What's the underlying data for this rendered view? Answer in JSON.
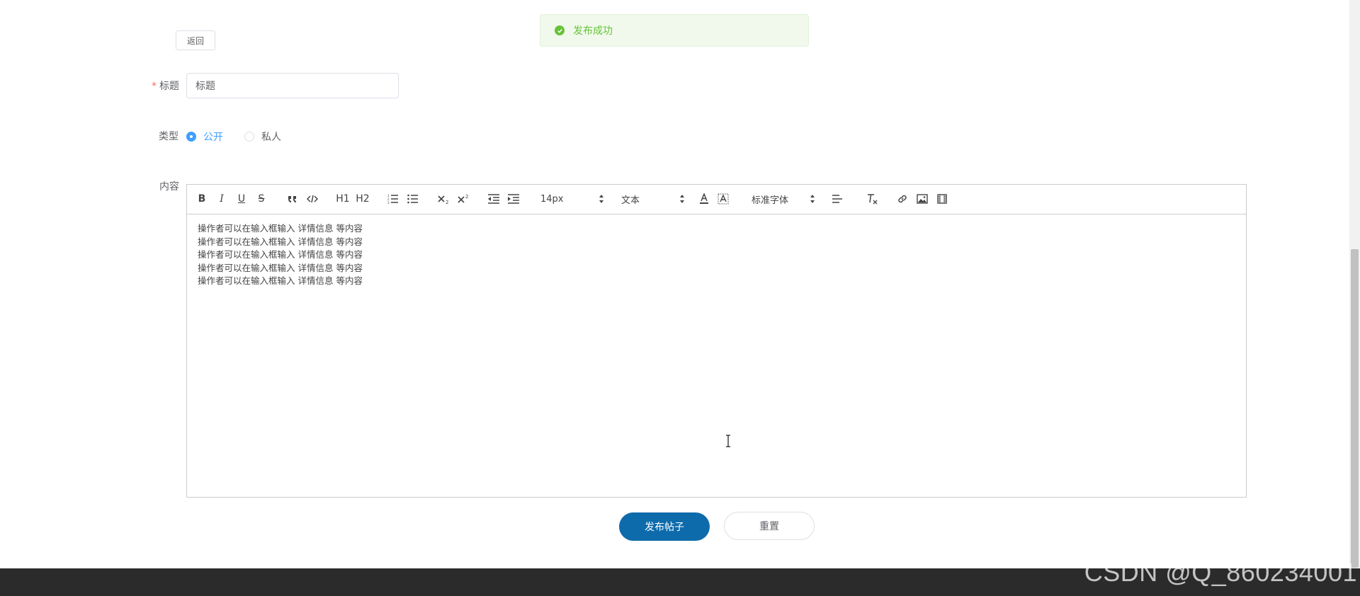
{
  "toast": {
    "message": "发布成功",
    "icon": "success-check-icon",
    "color": "#67c23a"
  },
  "back_button": {
    "label": "返回"
  },
  "form": {
    "title": {
      "required_mark": "*",
      "label": "标题",
      "value": "标题"
    },
    "type": {
      "label": "类型",
      "options": [
        {
          "label": "公开",
          "checked": true
        },
        {
          "label": "私人",
          "checked": false
        }
      ]
    },
    "content": {
      "label": "内容"
    }
  },
  "editor": {
    "toolbar": {
      "bold": "B",
      "italic": "I",
      "underline": "U",
      "strike": "S",
      "h1": "H1",
      "h2": "H2",
      "size": "14px",
      "header": "文本",
      "font": "标准字体"
    },
    "lines": [
      "操作者可以在输入框输入 详情信息 等内容",
      "操作者可以在输入框输入 详情信息 等内容",
      "操作者可以在输入框输入 详情信息 等内容",
      "操作者可以在输入框输入 详情信息 等内容",
      "操作者可以在输入框输入 详情信息 等内容"
    ]
  },
  "actions": {
    "submit": "发布帖子",
    "reset": "重置"
  },
  "watermark": "CSDN @Q_860234001",
  "colors": {
    "primary": "#409eff",
    "submit": "#0e6bab",
    "footer": "#2b2b2b"
  }
}
